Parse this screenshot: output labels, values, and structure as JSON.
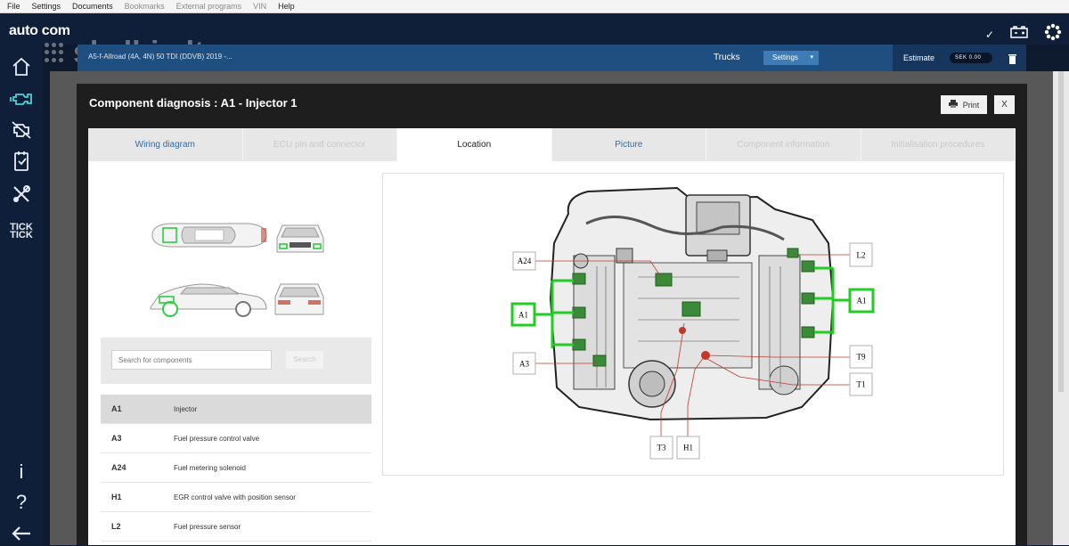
{
  "menubar": {
    "items": [
      {
        "label": "File",
        "enabled": true
      },
      {
        "label": "Settings",
        "enabled": true
      },
      {
        "label": "Documents",
        "enabled": true
      },
      {
        "label": "Bookmarks",
        "enabled": false
      },
      {
        "label": "External programs",
        "enabled": false
      },
      {
        "label": "VIN",
        "enabled": false
      },
      {
        "label": "Help",
        "enabled": true
      }
    ]
  },
  "brand": {
    "logo": "auto com",
    "watermark": "skelbiu.lt"
  },
  "sidebar": {
    "tick_label": "TICK TICK"
  },
  "vehicle_bar": {
    "vehicle": "A5-f-Allroad (4A, 4N) 50 TDI (DDVB) 2019 -...",
    "trucks": "Trucks",
    "settings": "Settings",
    "estimate": "Estimate",
    "estimate_value": "SEK 0.00"
  },
  "dialog": {
    "title": "Component diagnosis : A1 - Injector 1",
    "print": "Print",
    "close": "X",
    "tabs": [
      {
        "label": "Wiring diagram",
        "state": "link"
      },
      {
        "label": "ECU pin and connector",
        "state": "disabled"
      },
      {
        "label": "Location",
        "state": "active"
      },
      {
        "label": "Picture",
        "state": "link"
      },
      {
        "label": "Component information",
        "state": "disabled"
      },
      {
        "label": "Initialisation procedures",
        "state": "disabled"
      }
    ],
    "search": {
      "placeholder": "Search for components",
      "button": "Search"
    },
    "components": [
      {
        "code": "A1",
        "name": "Injector",
        "selected": true
      },
      {
        "code": "A3",
        "name": "Fuel pressure control valve",
        "selected": false
      },
      {
        "code": "A24",
        "name": "Fuel metering solenoid",
        "selected": false
      },
      {
        "code": "H1",
        "name": "EGR control valve with position sensor",
        "selected": false
      },
      {
        "code": "L2",
        "name": "Fuel pressure sensor",
        "selected": false
      }
    ]
  },
  "diagram": {
    "labels": {
      "a24": "A24",
      "a1_left": "A1",
      "a3": "A3",
      "l2": "L2",
      "a1_right": "A1",
      "t9": "T9",
      "t1": "T1",
      "t3": "T3",
      "h1": "H1"
    }
  },
  "colors": {
    "accent": "#2c6ea6",
    "highlight": "#22cc22",
    "navy": "#0f1f3a",
    "vehicle_bar": "#1f4e80"
  }
}
